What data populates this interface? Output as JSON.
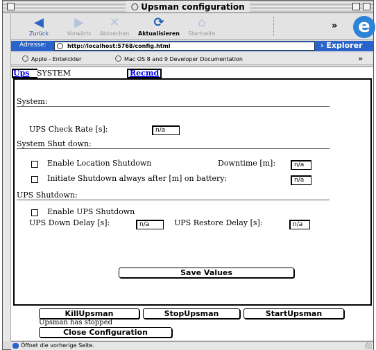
{
  "window": {
    "title": "Upsman configuration"
  },
  "toolbar": {
    "back": "Zurück",
    "forward": "Vorwärts",
    "stop": "Abbrechen",
    "refresh": "Aktualisieren",
    "home": "Startseite",
    "more": "»"
  },
  "address": {
    "label": "Adresse:",
    "url": "http://localhost:5768/config.html",
    "explorer": "Explorer"
  },
  "favorites": {
    "items": [
      "Apple - Entwickler",
      "Mac OS 8 and 9 Developer Documentation"
    ],
    "more": "»"
  },
  "tabs": {
    "ups": "Ups",
    "current": "SYSTEM",
    "recmd": "Recmd"
  },
  "system": {
    "title": "System:",
    "check_rate_label": "UPS Check Rate [s]:",
    "check_rate_value": "n/a"
  },
  "shutdown": {
    "title": "System Shut down:",
    "enable_location_label": "Enable Location Shutdown",
    "downtime_label": "Downtime [m]:",
    "downtime_value": "n/a",
    "initiate_label": "Initiate Shutdown always after [m] on battery:",
    "initiate_value": "n/a"
  },
  "ups_shutdown": {
    "title": "UPS Shutdown:",
    "enable_label": "Enable UPS Shutdown",
    "down_delay_label": "UPS Down Delay [s]:",
    "down_delay_value": "n/a",
    "restore_delay_label": "UPS Restore Delay [s]:",
    "restore_delay_value": "n/a"
  },
  "actions": {
    "save": "Save Values",
    "kill": "KillUpsman",
    "stop": "StopUpsman",
    "start": "StartUpsman",
    "status": "Upsman has stopped",
    "close": "Close Configuration"
  },
  "statusbar": {
    "text": "Öffnet die vorherige Seite."
  }
}
